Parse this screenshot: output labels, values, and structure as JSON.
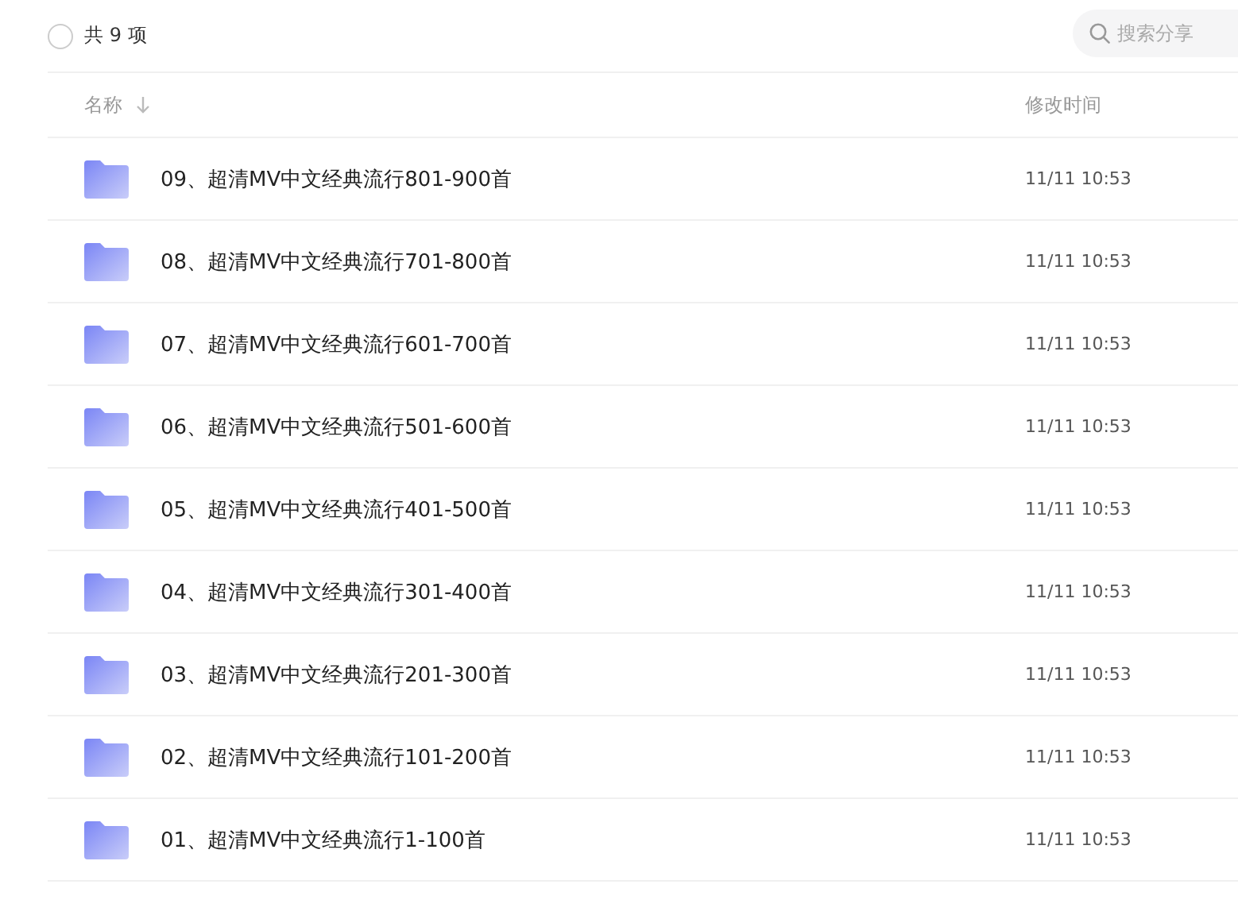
{
  "toolbar": {
    "select_all": {
      "checked": false
    },
    "count_label": "共 9 项",
    "search": {
      "placeholder": "搜索分享"
    }
  },
  "table": {
    "columns": [
      {
        "label": "名称",
        "sorted": true
      },
      {
        "label": "修改时间",
        "sorted": false
      }
    ],
    "rows": [
      {
        "name": "09、超清MV中文经典流行801-900首",
        "modified": "11/11 10:53"
      },
      {
        "name": "08、超清MV中文经典流行701-800首",
        "modified": "11/11 10:53"
      },
      {
        "name": "07、超清MV中文经典流行601-700首",
        "modified": "11/11 10:53"
      },
      {
        "name": "06、超清MV中文经典流行501-600首",
        "modified": "11/11 10:53"
      },
      {
        "name": "05、超清MV中文经典流行401-500首",
        "modified": "11/11 10:53"
      },
      {
        "name": "04、超清MV中文经典流行301-400首",
        "modified": "11/11 10:53"
      },
      {
        "name": "03、超清MV中文经典流行201-300首",
        "modified": "11/11 10:53"
      },
      {
        "name": "02、超清MV中文经典流行101-200首",
        "modified": "11/11 10:53"
      },
      {
        "name": "01、超清MV中文经典流行1-100首",
        "modified": "11/11 10:53"
      }
    ]
  }
}
